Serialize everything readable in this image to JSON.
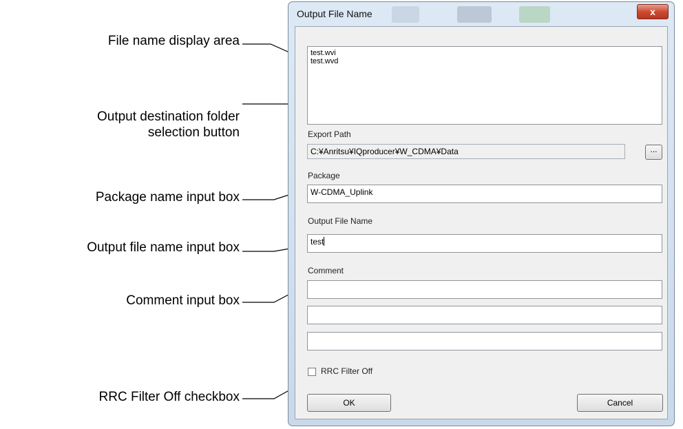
{
  "callouts": {
    "file_name_display_area": "File name display area",
    "output_destination_line1": "Output destination folder",
    "output_destination_line2": "selection button",
    "package_name_input": "Package name input box",
    "output_file_name_input": "Output file name input box",
    "comment_input": "Comment input box",
    "rrc_filter_checkbox": "RRC Filter Off checkbox"
  },
  "dialog": {
    "title": "Output File Name",
    "close_glyph": "x",
    "file_list": [
      "test.wvi",
      "test.wvd"
    ],
    "export_path": {
      "label": "Export Path",
      "value": "C:¥Anritsu¥IQproducer¥W_CDMA¥Data",
      "browse_label": "..."
    },
    "package": {
      "label": "Package",
      "value": "W-CDMA_Uplink"
    },
    "output_file_name": {
      "label": "Output File Name",
      "value": "test"
    },
    "comment": {
      "label": "Comment",
      "lines": [
        "",
        "",
        ""
      ]
    },
    "rrc_filter": {
      "label": "RRC Filter Off",
      "checked": false
    },
    "ok_label": "OK",
    "cancel_label": "Cancel"
  },
  "colors": {
    "titlebar": "#dde9f5",
    "client": "#f0f0f0",
    "close_button": "#cd4a32"
  }
}
